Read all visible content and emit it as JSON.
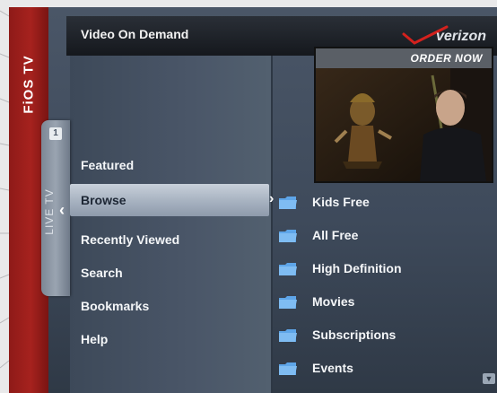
{
  "app": {
    "brand": "FiOS TV"
  },
  "live_tv": {
    "channel": "1",
    "label": "LIVE TV"
  },
  "header": {
    "title": "Video On Demand",
    "logo_text": "verizon"
  },
  "preview": {
    "promo_text": "ORDER NOW"
  },
  "menu": {
    "items": [
      {
        "label": "Featured"
      },
      {
        "label": "Browse"
      },
      {
        "label": "Recently Viewed"
      },
      {
        "label": "Search"
      },
      {
        "label": "Bookmarks"
      },
      {
        "label": "Help"
      }
    ],
    "selected_index": 1
  },
  "categories": {
    "items": [
      {
        "label": "Kids Free",
        "icon": "folder-icon"
      },
      {
        "label": "All Free",
        "icon": "folder-icon"
      },
      {
        "label": "High Definition",
        "icon": "folder-icon"
      },
      {
        "label": "Movies",
        "icon": "folder-icon"
      },
      {
        "label": "Subscriptions",
        "icon": "folder-icon"
      },
      {
        "label": "Events",
        "icon": "folder-icon"
      }
    ]
  },
  "colors": {
    "brand_red": "#a6221e",
    "verizon_red": "#d3211d",
    "folder_blue": "#5ea5e8"
  }
}
